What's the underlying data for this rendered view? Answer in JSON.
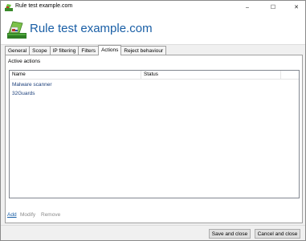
{
  "window": {
    "title": "Rule test example.com",
    "controls": {
      "minimize": "–",
      "maximize": "☐",
      "close": "✕"
    }
  },
  "header": {
    "title": "Rule test example.com",
    "accent_color": "#1a5fa6"
  },
  "tabs": [
    {
      "label": "General",
      "active": false
    },
    {
      "label": "Scope",
      "active": false
    },
    {
      "label": "IP filtering",
      "active": false
    },
    {
      "label": "Filters",
      "active": false
    },
    {
      "label": "Actions",
      "active": true
    },
    {
      "label": "Reject behaviour",
      "active": false
    }
  ],
  "actions_panel": {
    "section_label": "Active actions",
    "columns": [
      "Name",
      "Status"
    ],
    "rows": [
      {
        "name": "Malware scanner",
        "status": ""
      },
      {
        "name": "32Guards",
        "status": ""
      }
    ],
    "links": {
      "add": "Add",
      "modify": "Modify",
      "remove": "Remove"
    }
  },
  "footer": {
    "save_label": "Save and close",
    "cancel_label": "Cancel and close"
  }
}
